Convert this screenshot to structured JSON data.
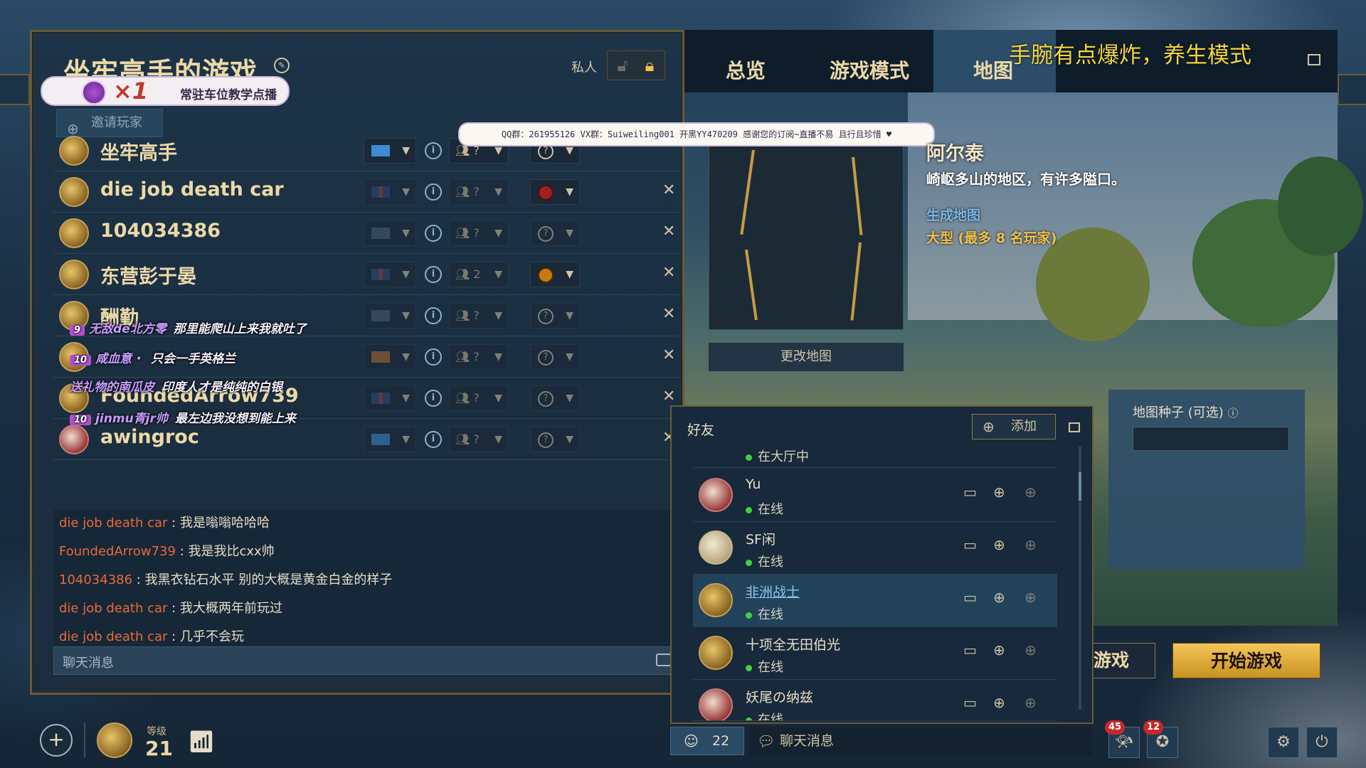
{
  "lobby": {
    "title": "坐牢高手的游戏",
    "private_label": "私人",
    "invite_label": "邀请玩家",
    "banner": {
      "multiplier": "×1",
      "text": "常驻车位教学点播"
    },
    "players": [
      {
        "name": "坐牢高手",
        "team": "?",
        "color": "?",
        "kickable": false
      },
      {
        "name": "die job death car",
        "team": "?",
        "color": "",
        "kickable": true
      },
      {
        "name": "104034386",
        "team": "?",
        "color": "?",
        "kickable": true
      },
      {
        "name": "东营彭于晏",
        "team": "2",
        "color": "",
        "kickable": true
      },
      {
        "name": "酬勤",
        "team": "?",
        "color": "?",
        "kickable": true
      },
      {
        "name": "",
        "team": "?",
        "color": "?",
        "kickable": true
      },
      {
        "name": "FoundedArrow739",
        "team": "?",
        "color": "?",
        "kickable": true
      },
      {
        "name": "awingroc",
        "team": "?",
        "color": "?",
        "kickable": true
      }
    ],
    "chat": [
      {
        "who": "die job death car",
        "msg": "我是嗡嗡哈哈哈"
      },
      {
        "who": "FoundedArrow739",
        "msg": "我是我比cxx帅"
      },
      {
        "who": "104034386",
        "msg": "我黑衣钻石水平 别的大概是黄金白金的样子"
      },
      {
        "who": "die job death car",
        "msg": "我大概两年前玩过"
      },
      {
        "who": "die job death car",
        "msg": "几乎不会玩"
      }
    ],
    "chat_placeholder": "聊天消息"
  },
  "danmaku": [
    {
      "level": "9",
      "nick": "无敌de北方零",
      "msg": "那里能爬山上来我就吐了"
    },
    {
      "level": "10",
      "nick": "咸血意・",
      "msg": "只会一手英格兰"
    },
    {
      "level": "",
      "nick": "送礼物的南瓜皮",
      "msg": "印度人才是纯纯的白银"
    },
    {
      "level": "10",
      "nick": "jinmu青jr帅",
      "msg": "最左边我没想到能上来"
    }
  ],
  "tabs": {
    "overview": "总览",
    "mode": "游戏模式",
    "map": "地图"
  },
  "stream_title": "手腕有点爆炸，养生模式",
  "notice": "QQ群：261955126 VX群：Suiweiling001 开黑YY470209 感谢您的订阅~直播不易 且行且珍惜 ♥",
  "map": {
    "name": "阿尔泰",
    "description": "崎岖多山的地区，有许多隘口。",
    "generate_label": "生成地图",
    "size": "大型 (最多 8 名玩家)",
    "change_label": "更改地图",
    "seed_label": "地图种子 (可选)"
  },
  "buttons": {
    "start": "开始游戏",
    "leave": "游戏"
  },
  "friends": {
    "title": "好友",
    "add_label": "添加",
    "first_status": "在大厅中",
    "list": [
      {
        "name": "Yu",
        "status": "在线"
      },
      {
        "name": "SF闲",
        "status": "在线"
      },
      {
        "name": "非洲战士",
        "status": "在线"
      },
      {
        "name": "十项全无田伯光",
        "status": "在线"
      },
      {
        "name": "妖尾の纳兹",
        "status": "在线"
      }
    ]
  },
  "bottom": {
    "level_label": "等级",
    "level": "21",
    "friends_count": "22",
    "chat_label": "聊天消息",
    "notif1": "45",
    "notif2": "12"
  },
  "colors": {
    "accent_gold": "#ecd9a8",
    "chat_name": "#e86a3a",
    "online": "#3fd23f",
    "stream_title": "#f2d63e"
  }
}
